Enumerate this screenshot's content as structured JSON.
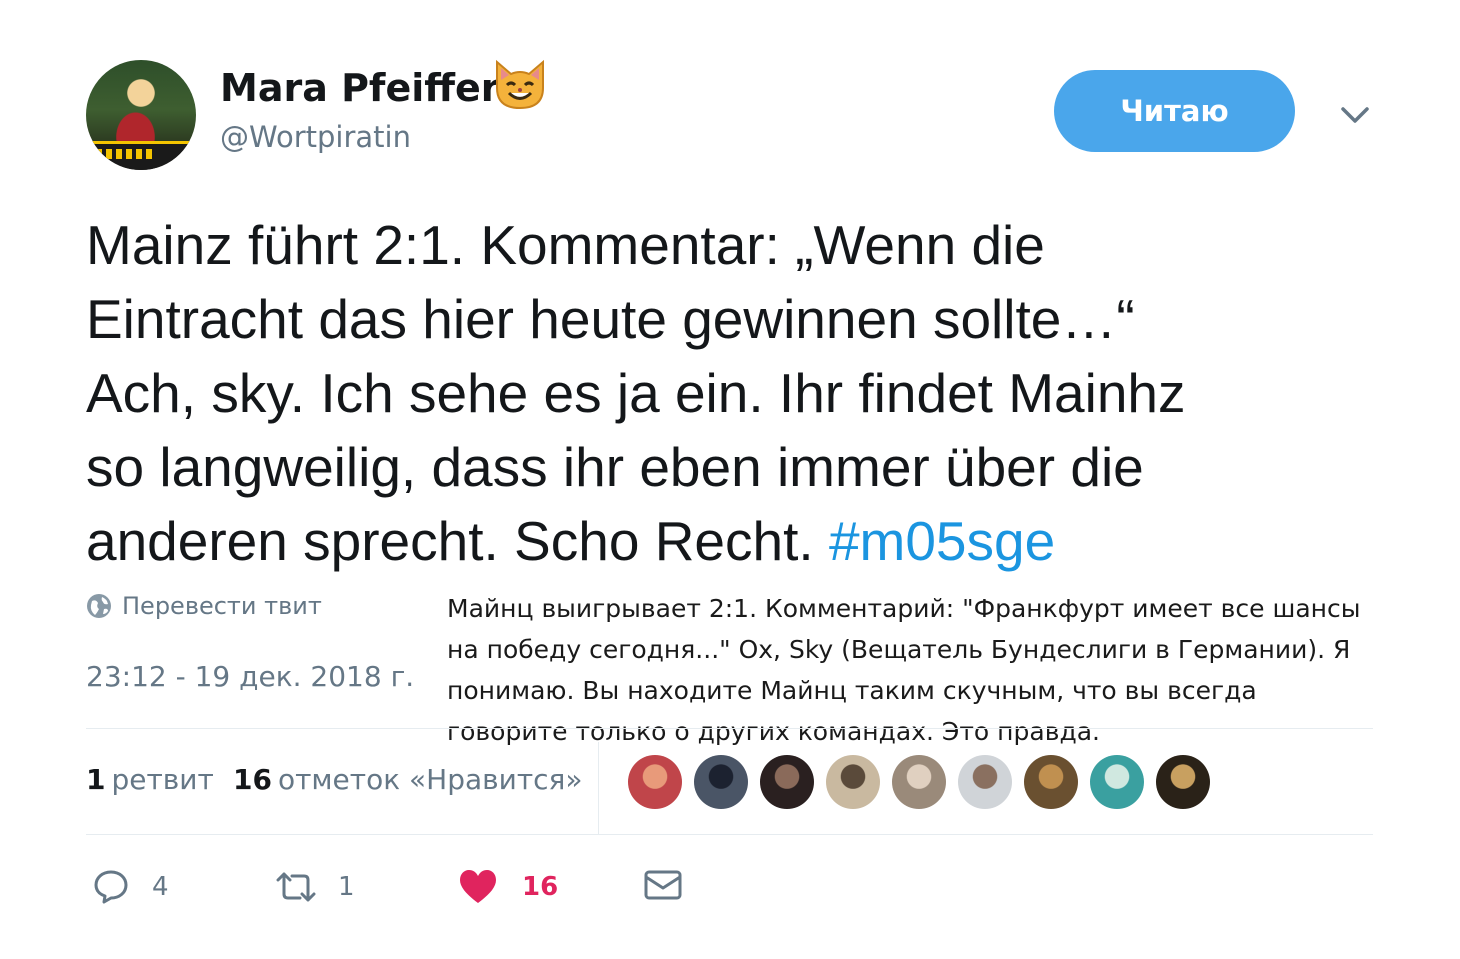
{
  "user": {
    "name": "Mara Pfeiffer",
    "handle": "@Wortpiratin",
    "badge_icon": "cat-emoji-icon"
  },
  "follow_button": {
    "label": "Читаю"
  },
  "tweet": {
    "lines": [
      "Mainz führt 2:1. Kommentar: „Wenn die",
      "Eintracht das hier heute gewinnen sollte…“",
      "Ach, sky. Ich sehe es ja ein. Ihr findet Mainhz",
      "so langweilig, dass ihr eben immer über die",
      "anderen sprecht. Scho Recht."
    ],
    "hashtag": "#m05sge"
  },
  "translate_link": "Перевести твит",
  "translation_overlay": {
    "lines": [
      "Майнц выигрывает 2:1. Комментарий: \"Франкфурт имеет все шансы",
      "на победу сегодня...\" Ох, Sky (Вещатель Бундеслиги в Германии). Я",
      "понимаю. Вы находите Майнц таким скучным, что вы всегда",
      "говорите только о других командах. Это правда."
    ]
  },
  "timestamp": "23:12 - 19 дек. 2018 г.",
  "stats": {
    "retweets_count": "1",
    "retweets_label": "ретвит",
    "likes_count": "16",
    "likes_label": "отметок «Нравится»"
  },
  "likers": [
    {
      "name": "liker-avatar-1",
      "colors": [
        "#c0454a",
        "#e89a7a"
      ]
    },
    {
      "name": "liker-avatar-2",
      "colors": [
        "#4a5566",
        "#1c2230"
      ]
    },
    {
      "name": "liker-avatar-3",
      "colors": [
        "#2a2020",
        "#8a6a5a"
      ]
    },
    {
      "name": "liker-avatar-4",
      "colors": [
        "#c9b9a0",
        "#5a4a3a"
      ]
    },
    {
      "name": "liker-avatar-5",
      "colors": [
        "#9a8a7a",
        "#e0d0c0"
      ]
    },
    {
      "name": "liker-avatar-6",
      "colors": [
        "#d0d4d8",
        "#8a7060"
      ]
    },
    {
      "name": "liker-avatar-7",
      "colors": [
        "#6a5030",
        "#c09050"
      ]
    },
    {
      "name": "liker-avatar-8",
      "colors": [
        "#3aa0a0",
        "#d0e8e0"
      ]
    },
    {
      "name": "liker-avatar-9",
      "colors": [
        "#2a2218",
        "#c8a060"
      ]
    }
  ],
  "actions": {
    "reply_count": "4",
    "retweet_count": "1",
    "like_count": "16"
  },
  "colors": {
    "accent": "#4aa6eb",
    "link": "#1b95e0",
    "like": "#e0245e",
    "muted": "#657786"
  }
}
